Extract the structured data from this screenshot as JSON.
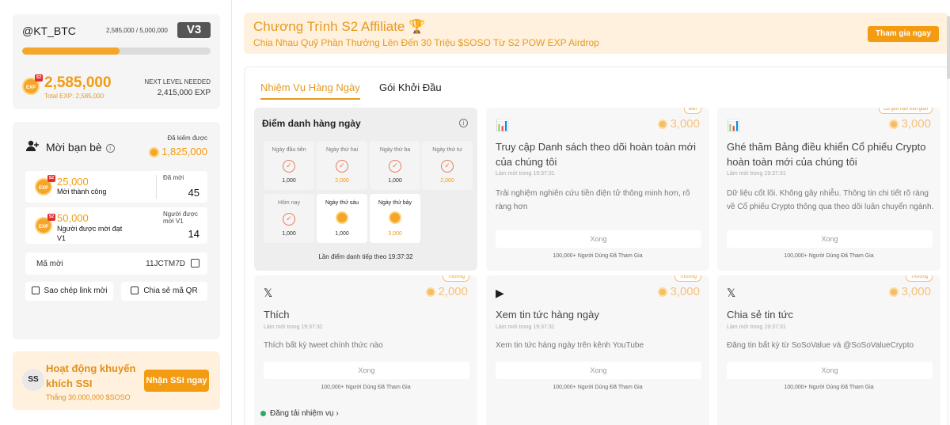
{
  "profile": {
    "username": "@KT_BTC",
    "exp_ratio": "2,585,000 / 5,000,000",
    "level": "V3",
    "progress": 0.517,
    "exp": "2,585,000",
    "total_exp": "Total EXP: 2,585,000",
    "next_level_label": "NEXT LEVEL NEEDED",
    "next_level_value": "2,415,000 EXP",
    "badge_text": "EXP",
    "badge_season": "S2"
  },
  "invite": {
    "title": "Mời bạn bè",
    "earned_label": "Đã kiếm được",
    "earned_value": "1,825,000",
    "stats": [
      {
        "value": "25,000",
        "desc": "Mời thành công",
        "right_label": "Đã mời",
        "right_value": "45"
      },
      {
        "value": "50,000",
        "desc": "Người được mời đạt V1",
        "right_label": "Người được mời V1",
        "right_value": "14"
      }
    ],
    "code_label": "Mã mời",
    "code_value": "11JCTM7D",
    "copy_link": "Sao chép link mời",
    "share_qr": "Chia sẻ mã QR"
  },
  "ssi": {
    "logo": "SS",
    "title": "Hoạt động khuyến khích SSI",
    "subtitle": "Thắng 30,000,000 $SOSO",
    "button": "Nhận SSI ngay"
  },
  "banner": {
    "title": "Chương Trình S2 Affiliate 🏆",
    "subtitle": "Chia Nhau Quỹ Phần Thưởng Lên Đến 30 Triệu $SOSO Từ S2 POW EXP Airdrop",
    "button": "Tham gia ngay"
  },
  "tabs": [
    "Nhiệm Vụ Hàng Ngày",
    "Gói Khởi Đầu"
  ],
  "checkin": {
    "title": "Điểm danh hàng ngày",
    "days": [
      {
        "label": "Ngày đầu tiên",
        "value": "1,000",
        "state": "done"
      },
      {
        "label": "Ngày thứ hai",
        "value": "2,000",
        "state": "done-orange"
      },
      {
        "label": "Ngày thứ ba",
        "value": "1,000",
        "state": "done"
      },
      {
        "label": "Ngày thứ tư",
        "value": "2,000",
        "state": "done-orange"
      },
      {
        "label": "Hôm nay",
        "value": "1,000",
        "state": "done"
      },
      {
        "label": "Ngày thứ sáu",
        "value": "1,000",
        "state": "coin"
      },
      {
        "label": "Ngày thứ bảy",
        "value": "3,000",
        "state": "coin-orange"
      }
    ],
    "next": "Lần điểm danh tiếp theo 19:37:32"
  },
  "tasks": [
    {
      "tag": "Mới",
      "icon": "chart-icon",
      "reward": "3,000",
      "title": "Truy cập Danh sách theo dõi hoàn toàn mới của chúng tôi",
      "time": "Làm mới trong 19:37:31",
      "desc": "Trải nghiệm nghiên cứu tiền điện tử thông minh hơn, rõ ràng hơn",
      "button": "Xong",
      "footer": "100,000+ Người Dùng Đã Tham Gia"
    },
    {
      "tag": "Có giới hạn thời gian",
      "icon": "chart-icon",
      "reward": "3,000",
      "title": "Ghé thăm Bảng điều khiển Cổ phiếu Crypto hoàn toàn mới của chúng tôi",
      "time": "Làm mới trong 19:37:31",
      "desc": "Dữ liệu cốt lõi. Không gây nhiễu. Thông tin chi tiết rõ ràng về Cổ phiếu Crypto thông qua theo dõi luân chuyển ngành.",
      "button": "Xong",
      "footer": "100,000+ Người Dùng Đã Tham Gia"
    },
    {
      "tag": "Thưởng",
      "icon": "x-icon",
      "reward": "2,000",
      "title": "Thích",
      "time": "Làm mới trong 19:37:31",
      "desc": "Thích bất kỳ tweet chính thức nào",
      "button": "Xong",
      "footer": "100,000+ Người Dùng Đã Tham Gia"
    },
    {
      "tag": "Thưởng",
      "icon": "youtube-icon",
      "reward": "3,000",
      "title": "Xem tin tức hàng ngày",
      "time": "Làm mới trong 19:37:31",
      "desc": "Xem tin tức hàng ngày trên kênh YouTube",
      "button": "Xong",
      "footer": "100,000+ Người Dùng Đã Tham Gia"
    },
    {
      "tag": "Thưởng",
      "icon": "x-icon",
      "reward": "3,000",
      "title": "Chia sẻ tin tức",
      "time": "Làm mới trong 19:37:31",
      "desc": "Đăng tin bất kỳ từ SoSoValue và @SoSoValueCrypto",
      "button": "Xong",
      "footer": "100,000+ Người Dùng Đã Tham Gia"
    }
  ],
  "loading": "Đăng tải nhiệm vụ"
}
